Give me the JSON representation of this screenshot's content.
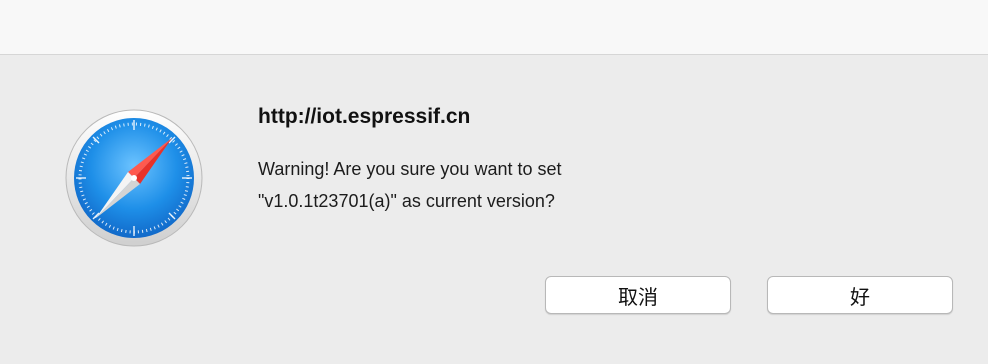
{
  "window": {
    "title_bar_text": ""
  },
  "dialog": {
    "app_icon": "safari-compass-icon",
    "title": "http://iot.espressif.cn",
    "message_line_1": "Warning! Are you sure you want to set",
    "message_line_2": "\"v1.0.1t23701(a)\" as current version?",
    "buttons": {
      "cancel_label": "取消",
      "ok_label": "好"
    }
  },
  "colors": {
    "dialog_background": "#ececec",
    "compass_blue": "#1e8fe8",
    "needle_red": "#e8322a"
  }
}
